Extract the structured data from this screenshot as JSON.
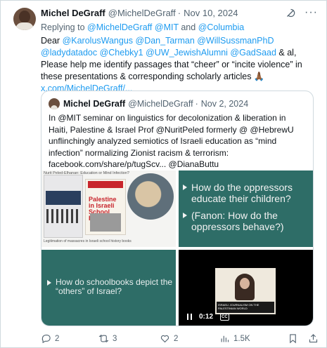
{
  "tweet": {
    "author_name": "Michel DeGraff",
    "author_handle": "@MichelDeGraff",
    "separator": "·",
    "date": "Nov 10, 2024",
    "reply_prefix": "Replying to",
    "reply_mention_1": "@MichelDeGraff",
    "reply_mention_2": "@MIT",
    "reply_and": "and",
    "reply_mention_3": "@Columbia",
    "text_dear": "Dear",
    "mentions_line": "@KarolusWangus @Dan_Tarman @WillSussmanPhD @ladydatadoc @Chebky1 @UW_JewishAlumni @GadSaad",
    "text_body": "& al, Please help me identify passages that “cheer” or “incite violence” in these presentations & corresponding scholarly articles 🙏🏾",
    "link": "x.com/MichelDeGraff/..."
  },
  "quote": {
    "author_name": "Michel DeGraff",
    "author_handle": "@MichelDeGraff",
    "separator": "·",
    "date": "Nov 2, 2024",
    "text": "In @MIT seminar on linguistics for decolonization & liberation in Haiti, Palestine & Israel Prof @NuritPeled formerly @ @HebrewU unflinchingly analyzed semiotics of Israeli education as “mind infection” normalizing Zionist racism & terrorism:  facebook.com/share/p/tugScv... @DianaButtu",
    "media": {
      "image1_top_caption": "Nurit Peled-Elhanan: Education or Mind Infection?",
      "image1_book_title": "Palestine in Israeli School Books",
      "image1_caption": "Legitimation of massacres in Israeli school history books",
      "slide2_line1": "How do the oppressors educate their children?",
      "slide2_line2": "(Fanon: How do the oppressors behave?)",
      "slide3_text": "How do schoolbooks depict the “others” of Israel?",
      "video_time": "0:12",
      "video_cc": "CC",
      "video_caption": "ISRAELI JOURNALISM ON THE PALESTINIAN WORLD"
    }
  },
  "actions": {
    "replies": "2",
    "reposts": "3",
    "likes": "2",
    "views": "1.5K"
  },
  "colors": {
    "link": "#1d9bf0",
    "muted": "#536471",
    "slide_bg": "#2e6d67"
  },
  "icons": [
    "grok-icon",
    "more-icon",
    "reply-icon",
    "repost-icon",
    "like-icon",
    "views-icon",
    "bookmark-icon",
    "share-icon",
    "pause-icon"
  ]
}
